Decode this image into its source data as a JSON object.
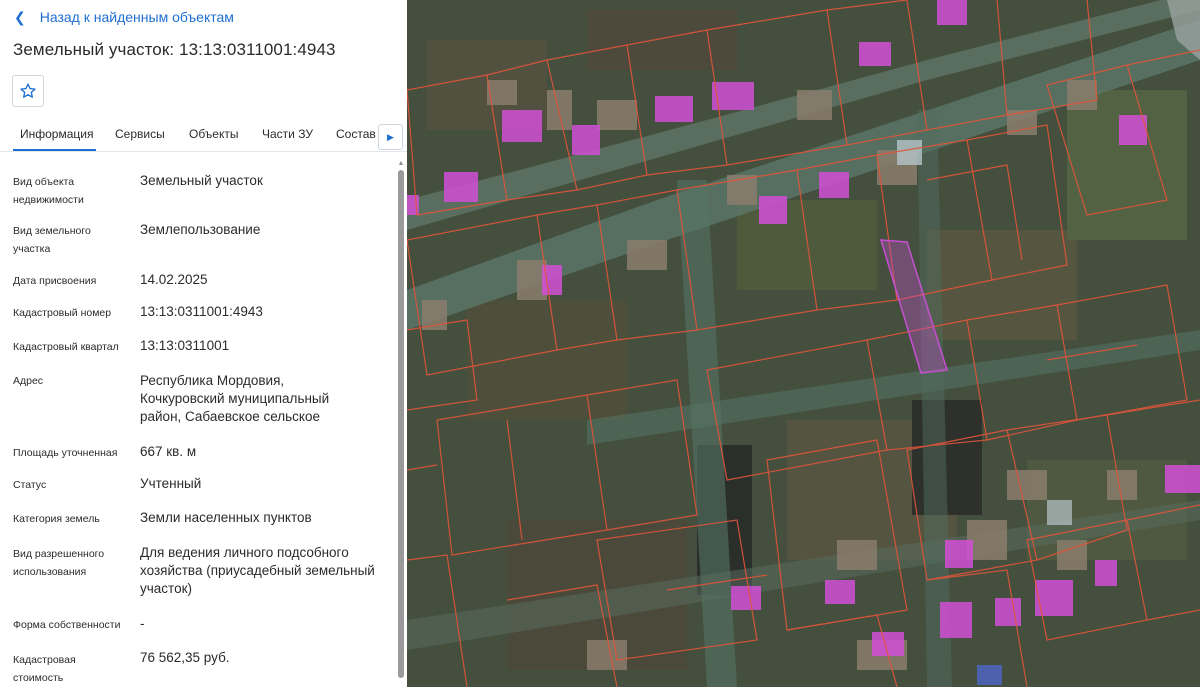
{
  "nav": {
    "back_label": "Назад к найденным объектам"
  },
  "header": {
    "title": "Земельный участок: 13:13:0311001:4943"
  },
  "favorite": {
    "icon": "star-icon"
  },
  "tabs": [
    {
      "label": "Информация",
      "active": true
    },
    {
      "label": "Сервисы",
      "active": false
    },
    {
      "label": "Объекты",
      "active": false
    },
    {
      "label": "Части ЗУ",
      "active": false
    },
    {
      "label": "Состав",
      "active": false
    }
  ],
  "properties": [
    {
      "label": "Вид объекта недвижимости",
      "value": "Земельный участок"
    },
    {
      "label": "Вид земельного участка",
      "value": "Землепользование"
    },
    {
      "label": "Дата присвоения",
      "value": "14.02.2025"
    },
    {
      "label": "Кадастровый номер",
      "value": "13:13:0311001:4943"
    },
    {
      "label": "Кадастровый квартал",
      "value": "13:13:0311001"
    },
    {
      "label": "Адрес",
      "value": "Республика Мордовия, Кочкуровский муниципальный район, Сабаевское сельское"
    },
    {
      "label": "Площадь уточненная",
      "value": "667 кв. м"
    },
    {
      "label": "Статус",
      "value": "Учтенный"
    },
    {
      "label": "Категория земель",
      "value": "Земли населенных пунктов"
    },
    {
      "label": "Вид разрешенного использования",
      "value": "Для ведения личного подсобного хозяйства (приусадебный земельный участок)"
    },
    {
      "label": "Форма собственности",
      "value": "-"
    },
    {
      "label": "Кадастровая стоимость",
      "value": "76 562,35 руб."
    }
  ],
  "colors": {
    "accent": "#1f6fd1",
    "parcel_border": "#e0553a",
    "building_fill": "#d24fd6",
    "selected_parcel": "#c64fd0"
  }
}
